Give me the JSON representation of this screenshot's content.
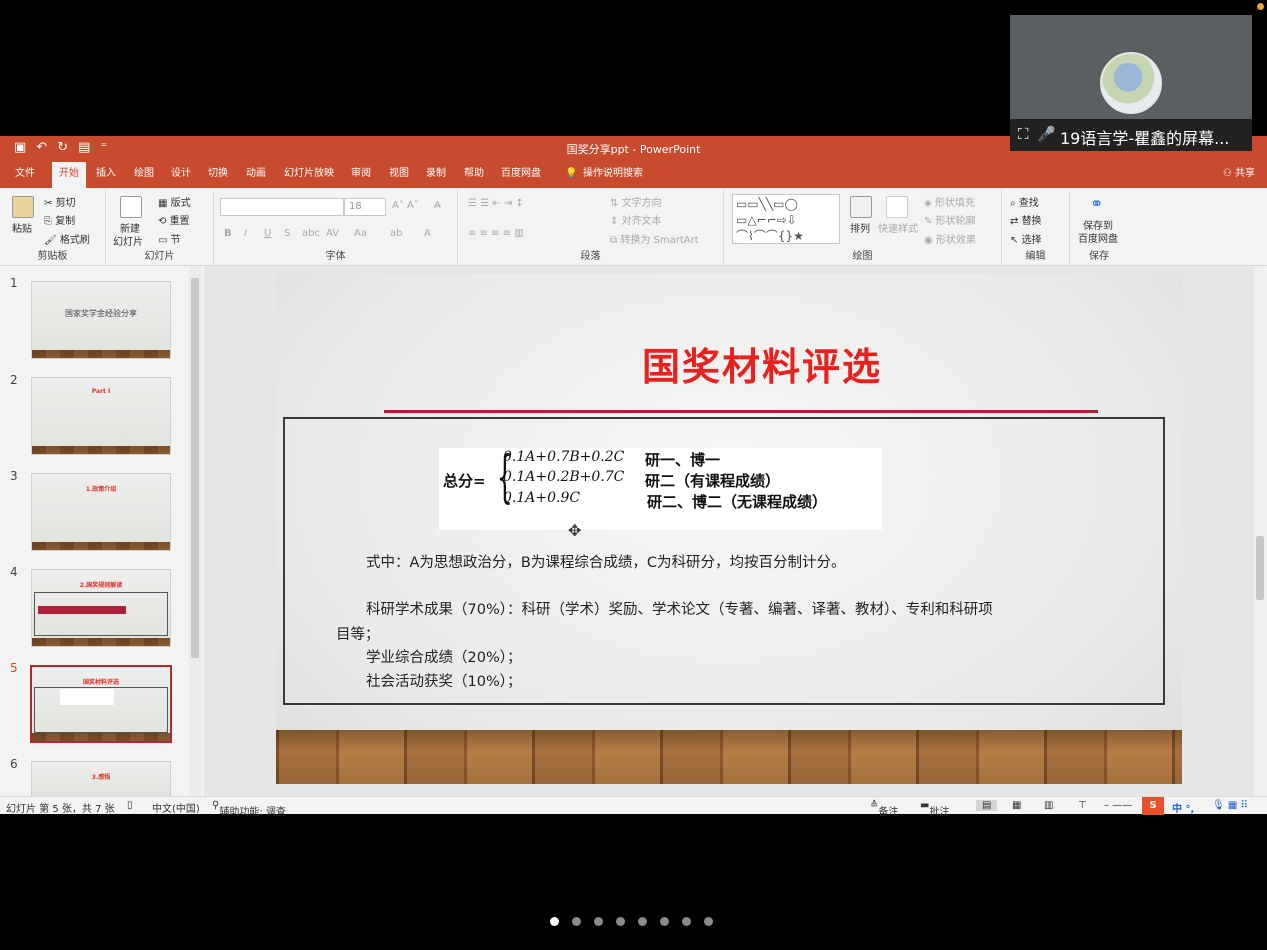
{
  "window": {
    "title": "国奖分享ppt - PowerPoint",
    "share": "共享"
  },
  "menu": [
    "文件",
    "开始",
    "插入",
    "绘图",
    "设计",
    "切换",
    "动画",
    "幻灯片放映",
    "审阅",
    "视图",
    "录制",
    "帮助",
    "百度网盘",
    "操作说明搜索"
  ],
  "ribbon": {
    "clipboard": {
      "paste": "粘贴",
      "cut": "剪切",
      "copy": "复制",
      "painter": "格式刷",
      "label": "剪贴板"
    },
    "slides": {
      "new": "新建",
      "new2": "幻灯片",
      "layout": "版式",
      "reset": "重置",
      "section": "节",
      "label": "幻灯片"
    },
    "font": {
      "size": "18",
      "label": "字体"
    },
    "paragraph": {
      "textdir": "文字方向",
      "align": "对齐文本",
      "smartart": "转换为 SmartArt",
      "label": "段落"
    },
    "drawing": {
      "arrange": "排列",
      "quickstyle": "快速样式",
      "fill": "形状填充",
      "outline": "形状轮廓",
      "effect": "形状效果",
      "label": "绘图"
    },
    "editing": {
      "find": "查找",
      "replace": "替换",
      "select": "选择",
      "label": "编辑"
    },
    "save": {
      "save1": "保存到",
      "save2": "百度网盘",
      "label": "保存"
    }
  },
  "thumbnails": [
    {
      "num": "1",
      "title": "国家奖学金经验分享"
    },
    {
      "num": "2",
      "title": "Part I"
    },
    {
      "num": "3",
      "title": "1.政策介绍"
    },
    {
      "num": "4",
      "title": "2.国奖规则解读"
    },
    {
      "num": "5",
      "title": "国奖材料评选"
    },
    {
      "num": "6",
      "title": "3.感悟"
    }
  ],
  "slide": {
    "title": "国奖材料评选",
    "formula": {
      "total": "总分=",
      "rows": [
        "0.1A+0.7B+0.2C",
        "0.1A+0.2B+0.7C",
        "0.1A+0.9C"
      ],
      "labels": [
        "研一、博一",
        "研二（有课程成绩）",
        "研二、博二（无课程成绩）"
      ]
    },
    "lines": [
      "式中：A为思想政治分，B为课程综合成绩，C为科研分，均按百分制计分。",
      "科研学术成果（70%）：科研（学术）奖励、学术论文（专著、编著、译著、教材）、专利和科研项",
      "目等；",
      "学业综合成绩（20%）；",
      "社会活动获奖（10%）；"
    ]
  },
  "status": {
    "slide": "幻灯片 第 5 张，共 7 张",
    "lang": "中文(中国)",
    "accessibility": "辅助功能: 调查",
    "notes": "备注",
    "comments": "批注"
  },
  "share": {
    "name": "19语言学-瞿鑫的屏幕..."
  },
  "pager": {
    "count": 8,
    "active": 0
  }
}
